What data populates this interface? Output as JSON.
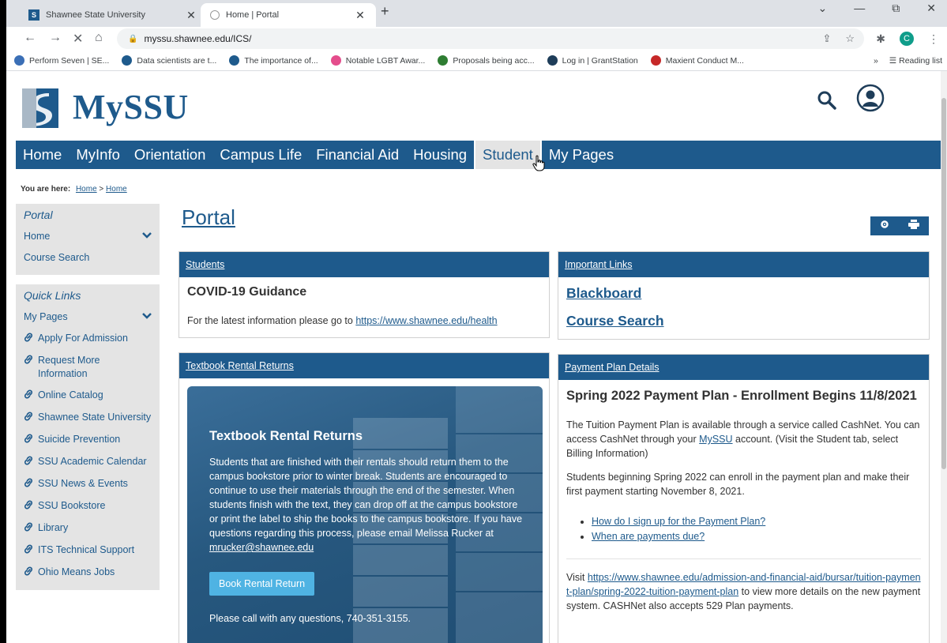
{
  "browser": {
    "tabs": [
      {
        "title": "Shawnee State University",
        "favicon": "ssu-logo-icon",
        "active": false
      },
      {
        "title": "Home | Portal",
        "favicon": "loading-icon",
        "active": true
      }
    ],
    "url": "myssu.shawnee.edu/ICS/",
    "bookmarks": [
      {
        "label": "Perform Seven | SE...",
        "color": "#3b6fb6"
      },
      {
        "label": "Data scientists are t...",
        "color": "#1e5a8c"
      },
      {
        "label": "The importance of...",
        "color": "#1e5a8c"
      },
      {
        "label": "Notable LGBT Awar...",
        "color": "#e44d8c"
      },
      {
        "label": "Proposals being acc...",
        "color": "#2e7d32"
      },
      {
        "label": "Log in | GrantStation",
        "color": "#1e3d59"
      },
      {
        "label": "Maxient Conduct M...",
        "color": "#c62828"
      }
    ],
    "more_bookmarks": "»",
    "reading_list": "Reading list",
    "profile_initial": "C"
  },
  "site": {
    "logo_text": "MySSU",
    "nav": [
      "Home",
      "MyInfo",
      "Orientation",
      "Campus Life",
      "Financial Aid",
      "Housing",
      "Student",
      "My Pages"
    ],
    "active_nav": 6,
    "breadcrumb": {
      "label": "You are here:",
      "home1": "Home",
      "sep": ">",
      "home2": "Home"
    }
  },
  "sidebar": {
    "portal_heading": "Portal",
    "portal_items": [
      "Home",
      "Course Search"
    ],
    "quick_heading": "Quick Links",
    "my_pages": "My Pages",
    "links": [
      "Apply For Admission",
      "Request More Information",
      "Online Catalog",
      "Shawnee State University",
      "Suicide Prevention",
      "SSU Academic Calendar",
      "SSU News & Events",
      "SSU Bookstore",
      "Library",
      "ITS Technical Support",
      "Ohio Means Jobs"
    ]
  },
  "main": {
    "title": "Portal",
    "students": {
      "header": "Students",
      "title": "COVID-19 Guidance",
      "text": "For the latest information please go to",
      "link": "https://www.shawnee.edu/health"
    },
    "important_links": {
      "header": "Important Links",
      "links": [
        "Blackboard",
        "Course Search"
      ]
    },
    "textbook": {
      "header": "Textbook Rental Returns",
      "title": "Textbook Rental Returns",
      "body": "Students that are finished with their rentals should return them to the campus bookstore prior to winter break. Students are encouraged to continue to use their materials through the end of the semester. When students finish with the text, they can drop off at the campus bookstore or print the label to ship the books to the campus bookstore. If you have questions regarding this process, please email Melissa Rucker at",
      "email": "mrucker@shawnee.edu",
      "button": "Book Rental Return",
      "call": "Please call with any questions, 740-351-3155."
    },
    "payment": {
      "header": "Payment Plan Details",
      "title": "Spring 2022 Payment Plan - Enrollment Begins 11/8/2021",
      "p1_a": "The Tuition Payment Plan is available through a service called CashNet. You can access CashNet through your",
      "p1_link": "MySSU",
      "p1_b": "account. (Visit the Student tab, select Billing Information)",
      "p2": "Students beginning Spring 2022 can enroll in the payment plan and make their first payment starting November 8, 2021.",
      "faq": [
        "How do I sign up for the Payment Plan?",
        "When are payments due?"
      ],
      "visit_a": "Visit",
      "visit_link": "https://www.shawnee.edu/admission-and-financial-aid/bursar/tuition-payment-plan/spring-2022-tuition-payment-plan",
      "visit_b": "to view more details on the new payment system. CASHNet also accepts 529 Plan payments."
    }
  },
  "colors": {
    "brand": "#1e5a8c",
    "button": "#4fb3e3",
    "sidebar_bg": "#e4e4e4"
  }
}
